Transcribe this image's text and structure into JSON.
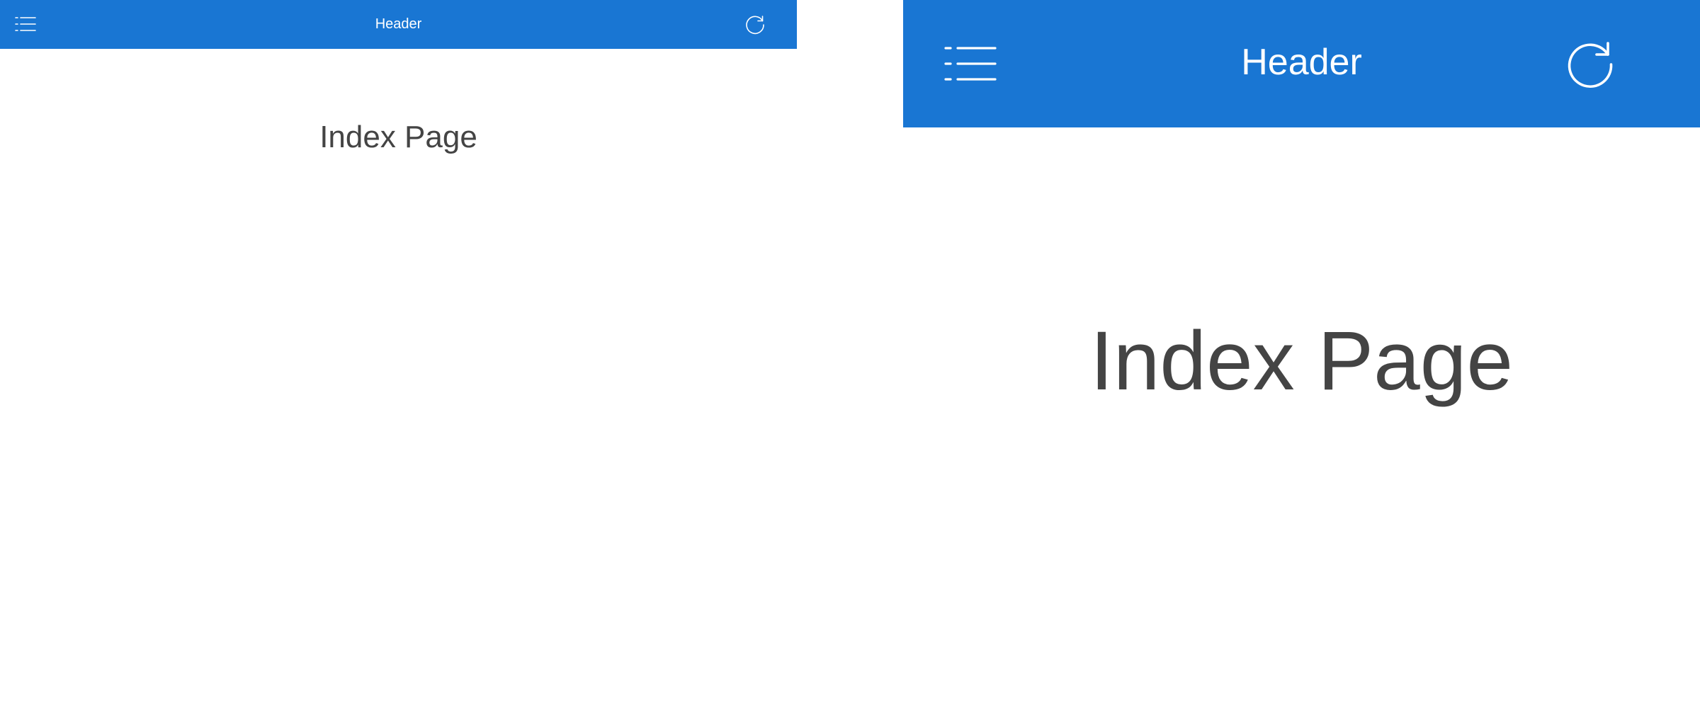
{
  "colors": {
    "header_background": "#1976d3",
    "header_text": "#ffffff",
    "page_background": "#ffffff",
    "page_title_text": "#444444"
  },
  "screens": [
    {
      "header": {
        "title": "Header",
        "menu_icon": "list-menu-icon",
        "refresh_icon": "refresh-icon"
      },
      "content": {
        "page_title": "Index Page"
      }
    },
    {
      "header": {
        "title": "Header",
        "menu_icon": "list-menu-icon",
        "refresh_icon": "refresh-icon"
      },
      "content": {
        "page_title": "Index Page"
      }
    }
  ]
}
